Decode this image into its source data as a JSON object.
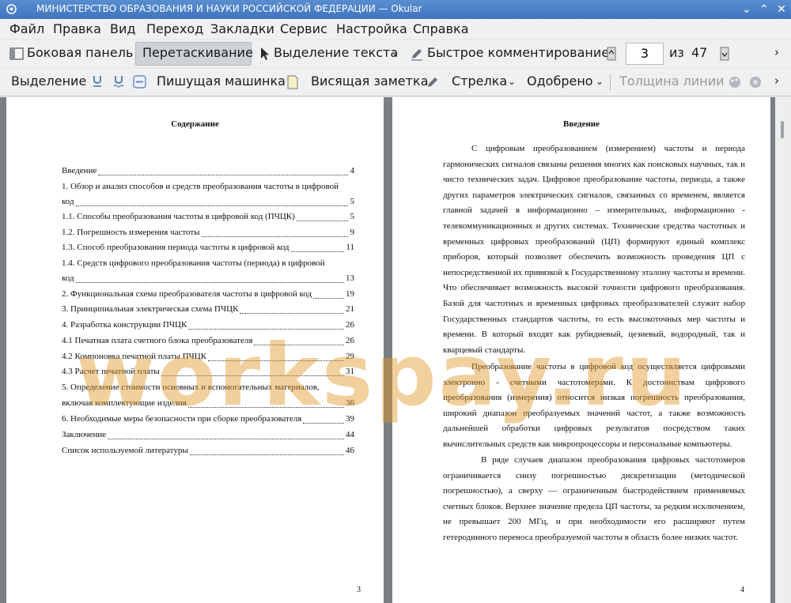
{
  "window": {
    "title": "МИНИСТЕРСТВО ОБРАЗОВАНИЯ И НАУКИ РОССИЙСКОЙ ФЕДЕРАЦИИ  — Okular"
  },
  "menu": [
    "Файл",
    "Правка",
    "Вид",
    "Переход",
    "Закладки",
    "Сервис",
    "Настройка",
    "Справка"
  ],
  "toolbar1": {
    "sidebar": "Боковая панель",
    "drag": "Перетаскивание",
    "text_select": "Выделение текста",
    "quick_comment": "Быстрое комментирование",
    "page": "3",
    "of": "из",
    "total": "47"
  },
  "toolbar2": {
    "highlight": "Выделение",
    "typewriter": "Пишущая машинка",
    "note": "Висящая заметка",
    "arrow": "Стрелка",
    "stamp": "Одобрено",
    "line_width": "Толщина линии"
  },
  "left_page": {
    "title": "Содержание",
    "toc": [
      {
        "text": "Введение",
        "page": "4"
      },
      {
        "text": "1. Обзор и анализ способов и средств преобразования частоты в цифровой",
        "page": ""
      },
      {
        "text": "код",
        "page": "5"
      },
      {
        "text": "1.1. Способы преобразования частоты в цифровой код (ПЧЦК)",
        "page": "5"
      },
      {
        "text": "1.2. Погрешность измерения частоты",
        "page": "9"
      },
      {
        "text": "1.3. Способ преобразования периода частоты в цифровой код",
        "page": "11"
      },
      {
        "text": "1.4. Средств цифрового преобразования частоты (периода) в цифровой",
        "page": ""
      },
      {
        "text": "код",
        "page": "13"
      },
      {
        "text": "2. Функциональная схема преобразователя частоты в цифровой код",
        "page": "19"
      },
      {
        "text": "3. Принципиальная электрическая схема ПЧЦК",
        "page": "21"
      },
      {
        "text": "4. Разработка конструкции ПЧЦК",
        "page": "26"
      },
      {
        "text": "4.1 Печатная плата счетного блока преобразователя",
        "page": "26"
      },
      {
        "text": "4.2 Компоновка печатной платы ПЧЦК",
        "page": "29"
      },
      {
        "text": "4.3 Расчет печатной платы",
        "page": "31"
      },
      {
        "text": "5. Определение стоимости основных и вспомогательных материалов,",
        "page": ""
      },
      {
        "text": "включая комплектующие изделия",
        "page": "36"
      },
      {
        "text": "6. Необходимые меры безопасности при сборке преобразователя",
        "page": "39"
      },
      {
        "text": "Заключение",
        "page": "44"
      },
      {
        "text": "Список используемой литературы",
        "page": "46"
      }
    ],
    "number": "3"
  },
  "right_page": {
    "title": "Введение",
    "paragraphs": [
      "С цифровым преобразованием (измерением) частоты и периода гармонических сигналов связаны решения многих как поисковых научных, так и чисто технических задач. Цифровое преобразование частоты, периода, а также других параметров электрических сигналов, связанных со временем, является главной задачей в информационно – измерительных, информационно - телекоммуникационных и других системах. Технические средства частотных и временных цифровых преобразований (ЦП) формируют единый комплекс приборов, который позволяет обеспечить возможность проведения ЦП с непосредственной их привязкой к Государственному эталону частоты и времени. Что обеспечивает возможность высокой точности цифрового преобразования. Базой для частотных и временных цифровых преобразователей служит набор Государственных стандартов частоты, то есть высокоточных мер частоты и времени. В который входят как рубидиевый, цезиевый, водородный, так и кварцевый стандарты.",
      "Преобразование частоты в цифровой код осуществляется цифровыми электронно - счетными частотомерами. К достоинствам цифрового преобразования (измерения) относится низкая погрешность преобразования, широкий диапазон преобразуемых значений частот, а также возможность дальнейшей обработки цифровых результатов посредством таких вычислительных средств как микропроцессоры и персональные компьютеры.",
      "В ряде случаев диапазон преобразования цифровых частотомеров ограничивается снизу погрешностью дискретизации (методической погрешностью), а сверху — ограниченным быстродействием применяемых счетных блоков. Верхнее значение предела ЦП частоты, за редким исключением, не превышает 200 МГц, и при необходимости его расширяют путем гетеродинного переноса преобразуемой частоты в область более низких частот."
    ],
    "number": "4"
  },
  "watermark": "workspay.ru"
}
